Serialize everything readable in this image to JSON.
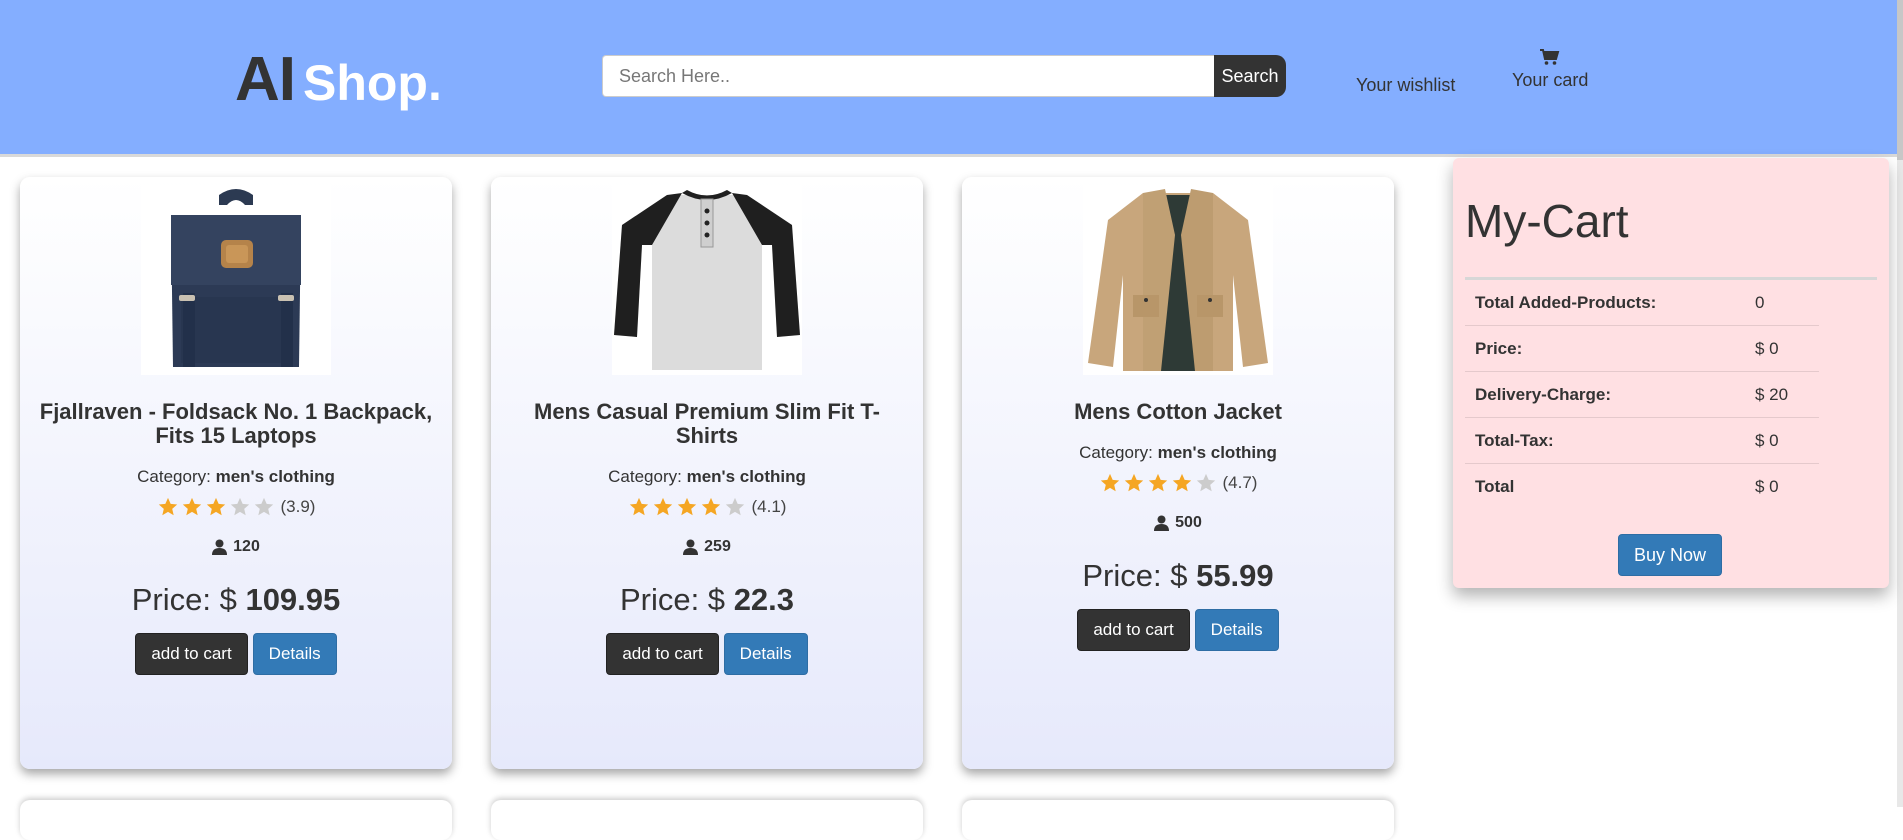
{
  "header": {
    "logo_part1": "AI",
    "logo_part2": "Shop.",
    "search_placeholder": "Search Here..",
    "search_button": "Search",
    "wishlist_label": "Your wishlist",
    "card_label": "Your card",
    "background_color": "#84aeff"
  },
  "products": [
    {
      "title": "Fjallraven - Foldsack No. 1 Backpack, Fits 15 Laptops",
      "category_label": "Category:",
      "category": "men's clothing",
      "rating": 3.9,
      "rating_text": "(3.9)",
      "stars_filled": 3,
      "reviews": "120",
      "price_label": "Price: $",
      "price": "109.95",
      "add_button": "add to cart",
      "details_button": "Details",
      "image_icon": "backpack-image"
    },
    {
      "title": "Mens Casual Premium Slim Fit T-Shirts",
      "category_label": "Category:",
      "category": "men's clothing",
      "rating": 4.1,
      "rating_text": "(4.1)",
      "stars_filled": 4,
      "reviews": "259",
      "price_label": "Price: $",
      "price": "22.3",
      "add_button": "add to cart",
      "details_button": "Details",
      "image_icon": "tshirt-image"
    },
    {
      "title": "Mens Cotton Jacket",
      "category_label": "Category:",
      "category": "men's clothing",
      "rating": 4.7,
      "rating_text": "(4.7)",
      "stars_filled": 4,
      "reviews": "500",
      "price_label": "Price: $",
      "price": "55.99",
      "add_button": "add to cart",
      "details_button": "Details",
      "image_icon": "jacket-image"
    }
  ],
  "cart": {
    "title": "My-Cart",
    "rows": [
      {
        "label": "Total Added-Products:",
        "value": "0"
      },
      {
        "label": "Price:",
        "value": "$ 0"
      },
      {
        "label": "Delivery-Charge:",
        "value": "$ 20"
      },
      {
        "label": "Total-Tax:",
        "value": "$ 0"
      },
      {
        "label": "Total",
        "value": "$ 0"
      }
    ],
    "buy_button": "Buy Now",
    "background_color": "#ffe0e3"
  },
  "colors": {
    "star_filled": "#f5a623",
    "star_empty": "#cccccc",
    "button_dark": "#333333",
    "button_blue": "#337ab7"
  }
}
